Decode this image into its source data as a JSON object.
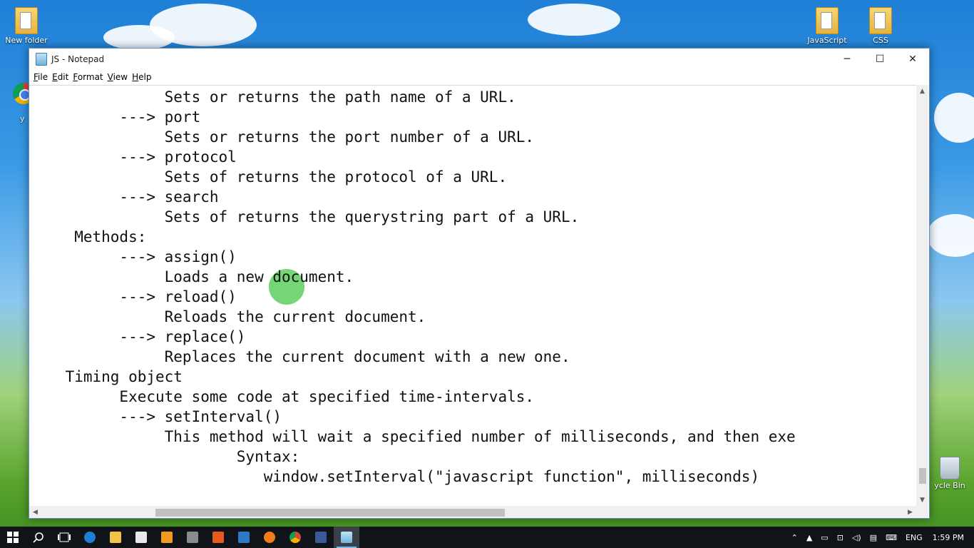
{
  "desktop": {
    "icons": [
      {
        "label": "New folder"
      },
      {
        "label": "JavaScript"
      },
      {
        "label": "CSS"
      }
    ],
    "side_label": "y",
    "recycle_label": "ycle Bin"
  },
  "window": {
    "title": "JS - Notepad",
    "controls": {
      "minimize": "─",
      "maximize": "☐",
      "close": "✕"
    },
    "menu": [
      "File",
      "Edit",
      "Format",
      "View",
      "Help"
    ]
  },
  "editor": {
    "lines": [
      "               Sets or returns the path name of a URL.",
      "          ---> port",
      "               Sets or returns the port number of a URL.",
      "          ---> protocol",
      "               Sets of returns the protocol of a URL.",
      "          ---> search",
      "               Sets of returns the querystring part of a URL.",
      "     Methods:",
      "          ---> assign()",
      "               Loads a new document.",
      "          ---> reload()",
      "               Reloads the current document.",
      "          ---> replace()",
      "               Replaces the current document with a new one.",
      "    Timing object",
      "          Execute some code at specified time-intervals.",
      "          ---> setInterval()",
      "               This method will wait a specified number of milliseconds, and then exe",
      "                       Syntax:",
      "                          window.setInterval(\"javascript function\", milliseconds)"
    ]
  },
  "taskbar": {
    "language": "ENG",
    "time": "1:59 PM"
  }
}
